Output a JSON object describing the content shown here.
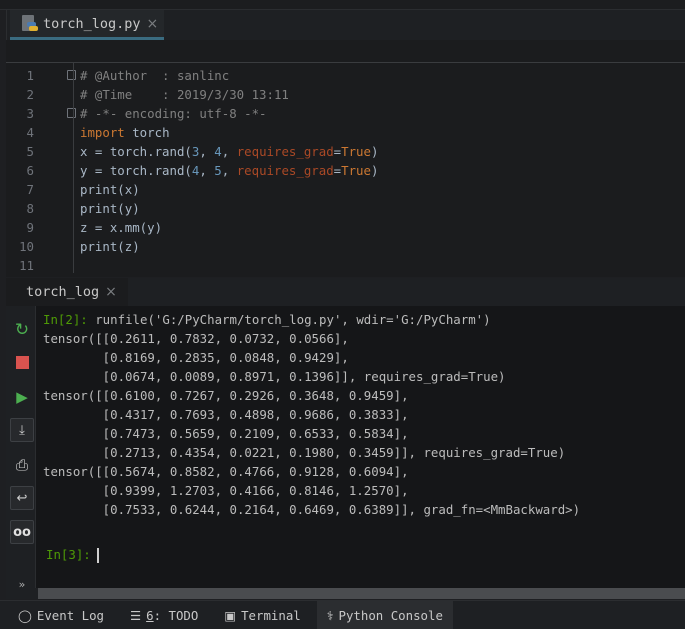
{
  "editor_tab": {
    "label": "torch_log.py",
    "icon": "python-file-icon",
    "close": "×"
  },
  "code_lines": [
    {
      "n": "1",
      "fold": true,
      "t": [
        [
          "# @Author  : sanlinc",
          "cm"
        ]
      ]
    },
    {
      "n": "2",
      "t": [
        [
          "# @Time    : 2019/3/30 13:11",
          "cm"
        ]
      ]
    },
    {
      "n": "3",
      "fold": true,
      "t": [
        [
          "# -*- encoding: utf-8 -*-",
          "cm"
        ]
      ]
    },
    {
      "n": "4",
      "t": [
        [
          "import",
          "kw"
        ],
        [
          " torch",
          "pl"
        ]
      ]
    },
    {
      "n": "5",
      "t": [
        [
          "x = torch.rand(",
          "pl"
        ],
        [
          "3",
          "num"
        ],
        [
          ", ",
          "pl"
        ],
        [
          "4",
          "num"
        ],
        [
          ", ",
          "pl"
        ],
        [
          "requires_grad",
          "prm"
        ],
        [
          "=",
          "pl"
        ],
        [
          "True",
          "kw"
        ],
        [
          ")",
          "pl"
        ]
      ]
    },
    {
      "n": "6",
      "t": [
        [
          "y = torch.rand(",
          "pl"
        ],
        [
          "4",
          "num"
        ],
        [
          ", ",
          "pl"
        ],
        [
          "5",
          "num"
        ],
        [
          ", ",
          "pl"
        ],
        [
          "requires_grad",
          "prm"
        ],
        [
          "=",
          "pl"
        ],
        [
          "True",
          "kw"
        ],
        [
          ")",
          "pl"
        ]
      ]
    },
    {
      "n": "7",
      "t": [
        [
          "print(x)",
          "pl"
        ]
      ]
    },
    {
      "n": "8",
      "t": [
        [
          "print(y)",
          "pl"
        ]
      ]
    },
    {
      "n": "9",
      "t": [
        [
          "z = x.mm(y)",
          "pl"
        ]
      ]
    },
    {
      "n": "10",
      "t": [
        [
          "print(z)",
          "pl"
        ]
      ]
    },
    {
      "n": "11",
      "t": []
    }
  ],
  "console_tab": {
    "label": "torch_log",
    "close": "×"
  },
  "console_lines": [
    {
      "prompt": "In[2]:",
      "text": " runfile('G:/PyCharm/torch_log.py', wdir='G:/PyCharm')"
    },
    {
      "text": "tensor([[0.2611, 0.7832, 0.0732, 0.0566],"
    },
    {
      "text": "        [0.8169, 0.2835, 0.0848, 0.9429],"
    },
    {
      "text": "        [0.0674, 0.0089, 0.8971, 0.1396]], requires_grad=True)"
    },
    {
      "text": "tensor([[0.6100, 0.7267, 0.2926, 0.3648, 0.9459],"
    },
    {
      "text": "        [0.4317, 0.7693, 0.4898, 0.9686, 0.3833],"
    },
    {
      "text": "        [0.7473, 0.5659, 0.2109, 0.6533, 0.5834],"
    },
    {
      "text": "        [0.2713, 0.4354, 0.0221, 0.1980, 0.3459]], requires_grad=True)"
    },
    {
      "text": "tensor([[0.5674, 0.8582, 0.4766, 0.9128, 0.6094],"
    },
    {
      "text": "        [0.9399, 1.2703, 0.4166, 0.8146, 1.2570],"
    },
    {
      "text": "        [0.7533, 0.6244, 0.2164, 0.6469, 0.6389]], grad_fn=<MmBackward>)"
    },
    {
      "text": ""
    },
    {
      "prompt": "In[3]:",
      "text": "",
      "caret": true
    }
  ],
  "toolbar": {
    "more": "»"
  },
  "bottom_tabs": [
    {
      "icon": "event-log-icon",
      "label": "Event Log"
    },
    {
      "icon": "todo-list-icon",
      "mnemonic": "6",
      "label": ": TODO"
    },
    {
      "icon": "terminal-icon",
      "label": "Terminal"
    },
    {
      "icon": "python-console-icon",
      "label": "Python Console",
      "active": true
    }
  ],
  "colors": {
    "keyword": "#cc7832",
    "number": "#6897bb",
    "string": "#6a8759",
    "comment": "#808080",
    "prompt": "#4e9a06",
    "tab_underline": "#3a6b80"
  }
}
